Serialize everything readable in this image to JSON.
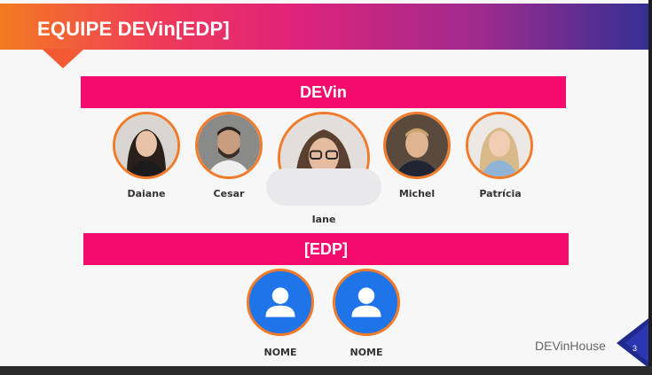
{
  "header": {
    "title": "EQUIPE DEVin[EDP]"
  },
  "devin": {
    "label": "DEVin",
    "members": [
      "Daiane",
      "Cesar",
      "Iane",
      "Michel",
      "Patrícia"
    ]
  },
  "edp": {
    "label": "[EDP]",
    "members": [
      "NOME",
      "NOME"
    ]
  },
  "footer": {
    "brand": "DEVinHouse",
    "page_number": "3"
  },
  "colors": {
    "band": "#f50b6d",
    "avatar_border": "#f07b2a",
    "user_icon_bg": "#1f74ea"
  }
}
